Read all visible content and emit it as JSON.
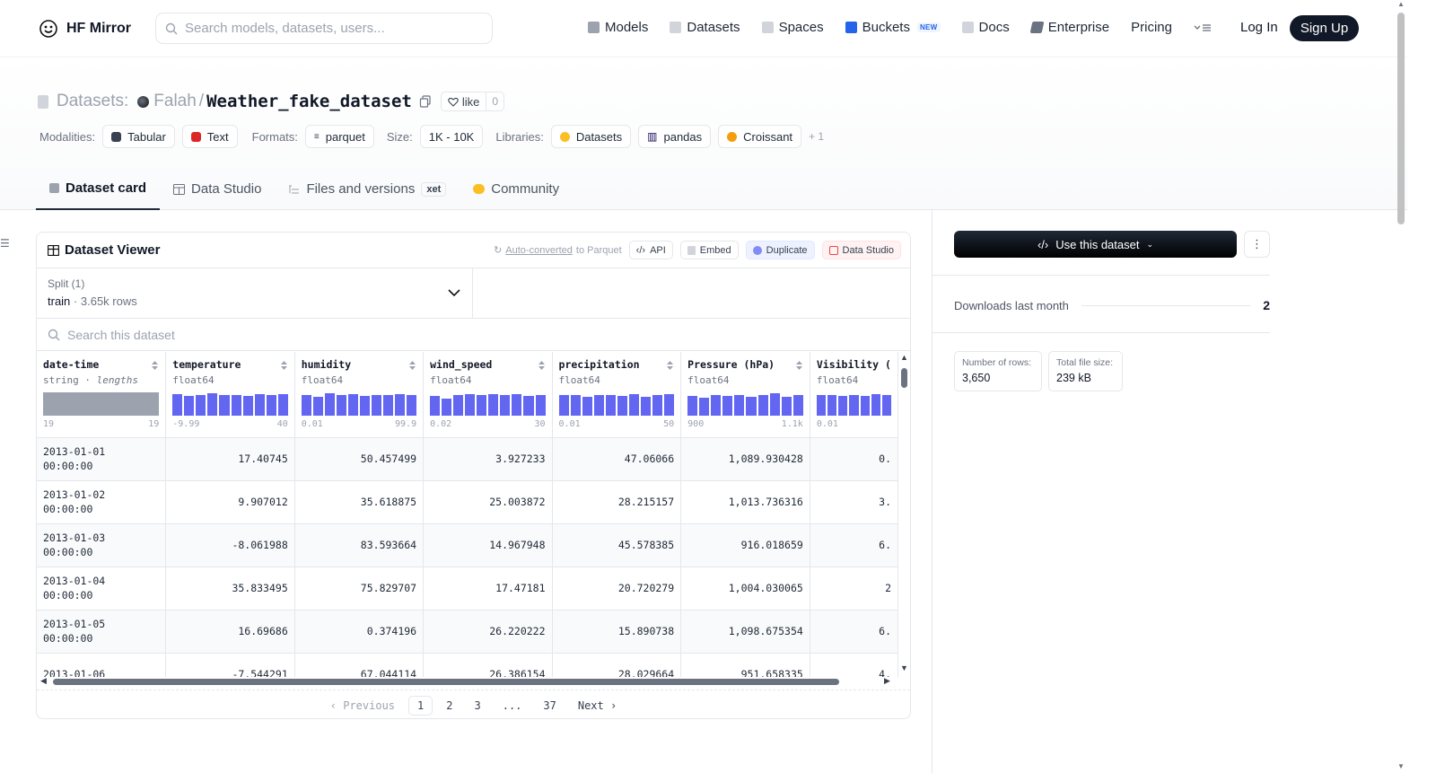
{
  "header": {
    "logo_text": "HF Mirror",
    "search_placeholder": "Search models, datasets, users...",
    "nav": [
      {
        "label": "Models",
        "icon": "cube-icon",
        "color": "#9ca3af"
      },
      {
        "label": "Datasets",
        "icon": "database-icon",
        "color": "#9ca3af"
      },
      {
        "label": "Spaces",
        "icon": "grid-icon",
        "color": "#9ca3af"
      },
      {
        "label": "Buckets",
        "icon": "bucket-icon",
        "color": "#2563eb"
      },
      {
        "label": "Docs",
        "icon": "book-icon",
        "color": "#9ca3af"
      },
      {
        "label": "Enterprise",
        "icon": "enterprise-icon",
        "color": "#6b7280"
      },
      {
        "label": "Pricing"
      }
    ],
    "buckets_badge": "NEW",
    "login_label": "Log In",
    "signup_label": "Sign Up"
  },
  "dataset": {
    "crumb_label": "Datasets:",
    "owner": "Falah",
    "separator": "/",
    "name": "Weather_fake_dataset",
    "like_label": "like",
    "like_count": "0",
    "modalities_label": "Modalities:",
    "modalities": [
      "Tabular",
      "Text"
    ],
    "formats_label": "Formats:",
    "formats": [
      "parquet"
    ],
    "size_label": "Size:",
    "size": "1K - 10K",
    "libraries_label": "Libraries:",
    "libraries": [
      "Datasets",
      "pandas",
      "Croissant"
    ],
    "libraries_more": "+ 1"
  },
  "tabs": [
    "Dataset card",
    "Data Studio",
    "Files and versions",
    "Community"
  ],
  "xet_badge": "xet",
  "viewer": {
    "title": "Dataset Viewer",
    "auto_converted": "Auto-converted",
    "auto_converted_suffix": "to Parquet",
    "api_label": "API",
    "embed_label": "Embed",
    "duplicate_label": "Duplicate",
    "data_studio_label": "Data Studio",
    "split_label": "Split (1)",
    "split_name": "train",
    "split_rows": "3.65k rows",
    "search_placeholder": "Search this dataset",
    "columns": [
      {
        "name": "date-time",
        "type": "string",
        "type_extra": "lengths",
        "min": "19",
        "max": "19",
        "hist": []
      },
      {
        "name": "temperature",
        "type": "float64",
        "min": "-9.99",
        "max": "40",
        "hist": [
          0.92,
          0.85,
          0.9,
          0.95,
          0.88,
          0.9,
          0.86,
          0.93,
          0.88,
          0.91
        ]
      },
      {
        "name": "humidity",
        "type": "float64",
        "min": "0.01",
        "max": "99.9",
        "hist": [
          0.88,
          0.8,
          0.95,
          0.9,
          0.92,
          0.85,
          0.9,
          0.88,
          0.93,
          0.9
        ]
      },
      {
        "name": "wind_speed",
        "type": "float64",
        "min": "0.02",
        "max": "30",
        "hist": [
          0.85,
          0.75,
          0.88,
          0.92,
          0.9,
          0.93,
          0.88,
          0.92,
          0.85,
          0.9
        ]
      },
      {
        "name": "precipitation",
        "type": "float64",
        "min": "0.01",
        "max": "50",
        "hist": [
          0.88,
          0.9,
          0.82,
          0.9,
          0.88,
          0.85,
          0.92,
          0.8,
          0.88,
          0.93
        ]
      },
      {
        "name": "Pressure (hPa)",
        "type": "float64",
        "min": "900",
        "max": "1.1k",
        "hist": [
          0.85,
          0.78,
          0.88,
          0.86,
          0.9,
          0.82,
          0.88,
          0.95,
          0.8,
          0.88
        ]
      },
      {
        "name": "Visibility (",
        "type": "float64",
        "min": "0.01",
        "max": "",
        "hist": [
          0.88,
          0.9,
          0.85,
          0.9,
          0.86,
          0.92,
          0.88
        ]
      }
    ],
    "rows": [
      {
        "date": "2013-01-01 00:00:00",
        "temperature": "17.40745",
        "humidity": "50.457499",
        "wind_speed": "3.927233",
        "precipitation": "47.06066",
        "pressure": "1,089.930428",
        "visibility": "0."
      },
      {
        "date": "2013-01-02 00:00:00",
        "temperature": "9.907012",
        "humidity": "35.618875",
        "wind_speed": "25.003872",
        "precipitation": "28.215157",
        "pressure": "1,013.736316",
        "visibility": "3."
      },
      {
        "date": "2013-01-03 00:00:00",
        "temperature": "-8.061988",
        "humidity": "83.593664",
        "wind_speed": "14.967948",
        "precipitation": "45.578385",
        "pressure": "916.018659",
        "visibility": "6."
      },
      {
        "date": "2013-01-04 00:00:00",
        "temperature": "35.833495",
        "humidity": "75.829707",
        "wind_speed": "17.47181",
        "precipitation": "20.720279",
        "pressure": "1,004.030065",
        "visibility": "2"
      },
      {
        "date": "2013-01-05 00:00:00",
        "temperature": "16.69686",
        "humidity": "0.374196",
        "wind_speed": "26.220222",
        "precipitation": "15.890738",
        "pressure": "1,098.675354",
        "visibility": "6."
      },
      {
        "date": "2013-01-06",
        "temperature": "-7.544291",
        "humidity": "67.044114",
        "wind_speed": "26.386154",
        "precipitation": "28.029664",
        "pressure": "951.658335",
        "visibility": "4."
      }
    ],
    "pager": {
      "previous": "Previous",
      "pages": [
        "1",
        "2",
        "3",
        "...",
        "37"
      ],
      "next": "Next"
    }
  },
  "sidebar": {
    "use_label": "Use this dataset",
    "downloads_label": "Downloads last month",
    "downloads_value": "2",
    "rows_label": "Number of rows:",
    "rows_value": "3,650",
    "size_label": "Total file size:",
    "size_value": "239 kB"
  },
  "colors": {
    "accent": "#6366f1",
    "dark": "#111827",
    "border": "#e5e7eb"
  }
}
